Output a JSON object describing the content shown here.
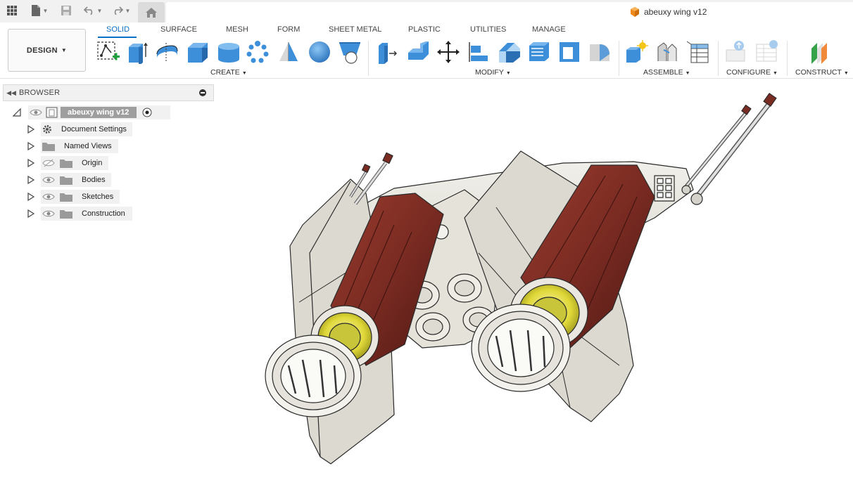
{
  "document": {
    "title": "abeuxy wing v12"
  },
  "workspace": {
    "label": "DESIGN"
  },
  "tabs": [
    {
      "label": "SOLID",
      "active": true
    },
    {
      "label": "SURFACE"
    },
    {
      "label": "MESH"
    },
    {
      "label": "FORM"
    },
    {
      "label": "SHEET METAL"
    },
    {
      "label": "PLASTIC"
    },
    {
      "label": "UTILITIES"
    },
    {
      "label": "MANAGE"
    }
  ],
  "groups": {
    "create": "CREATE",
    "modify": "MODIFY",
    "assemble": "ASSEMBLE",
    "configure": "CONFIGURE",
    "construct": "CONSTRUCT"
  },
  "browser": {
    "title": "BROWSER",
    "root": "abeuxy wing v12",
    "items": [
      {
        "label": "Document Settings",
        "icon": "gear-icon"
      },
      {
        "label": "Named Views",
        "icon": "folder-icon"
      },
      {
        "label": "Origin",
        "icon": "folder-icon",
        "visibility": "hidden"
      },
      {
        "label": "Bodies",
        "icon": "folder-icon",
        "visibility": "visible"
      },
      {
        "label": "Sketches",
        "icon": "folder-icon",
        "visibility": "visible"
      },
      {
        "label": "Construction",
        "icon": "folder-icon",
        "visibility": "visible"
      }
    ]
  },
  "colors": {
    "accent": "#0b6fc4",
    "tool_blue": "#3d8fd9",
    "body_metal": "#e3e1da",
    "engine_red": "#7a2b22",
    "lens_yellow": "#e8e24a"
  }
}
